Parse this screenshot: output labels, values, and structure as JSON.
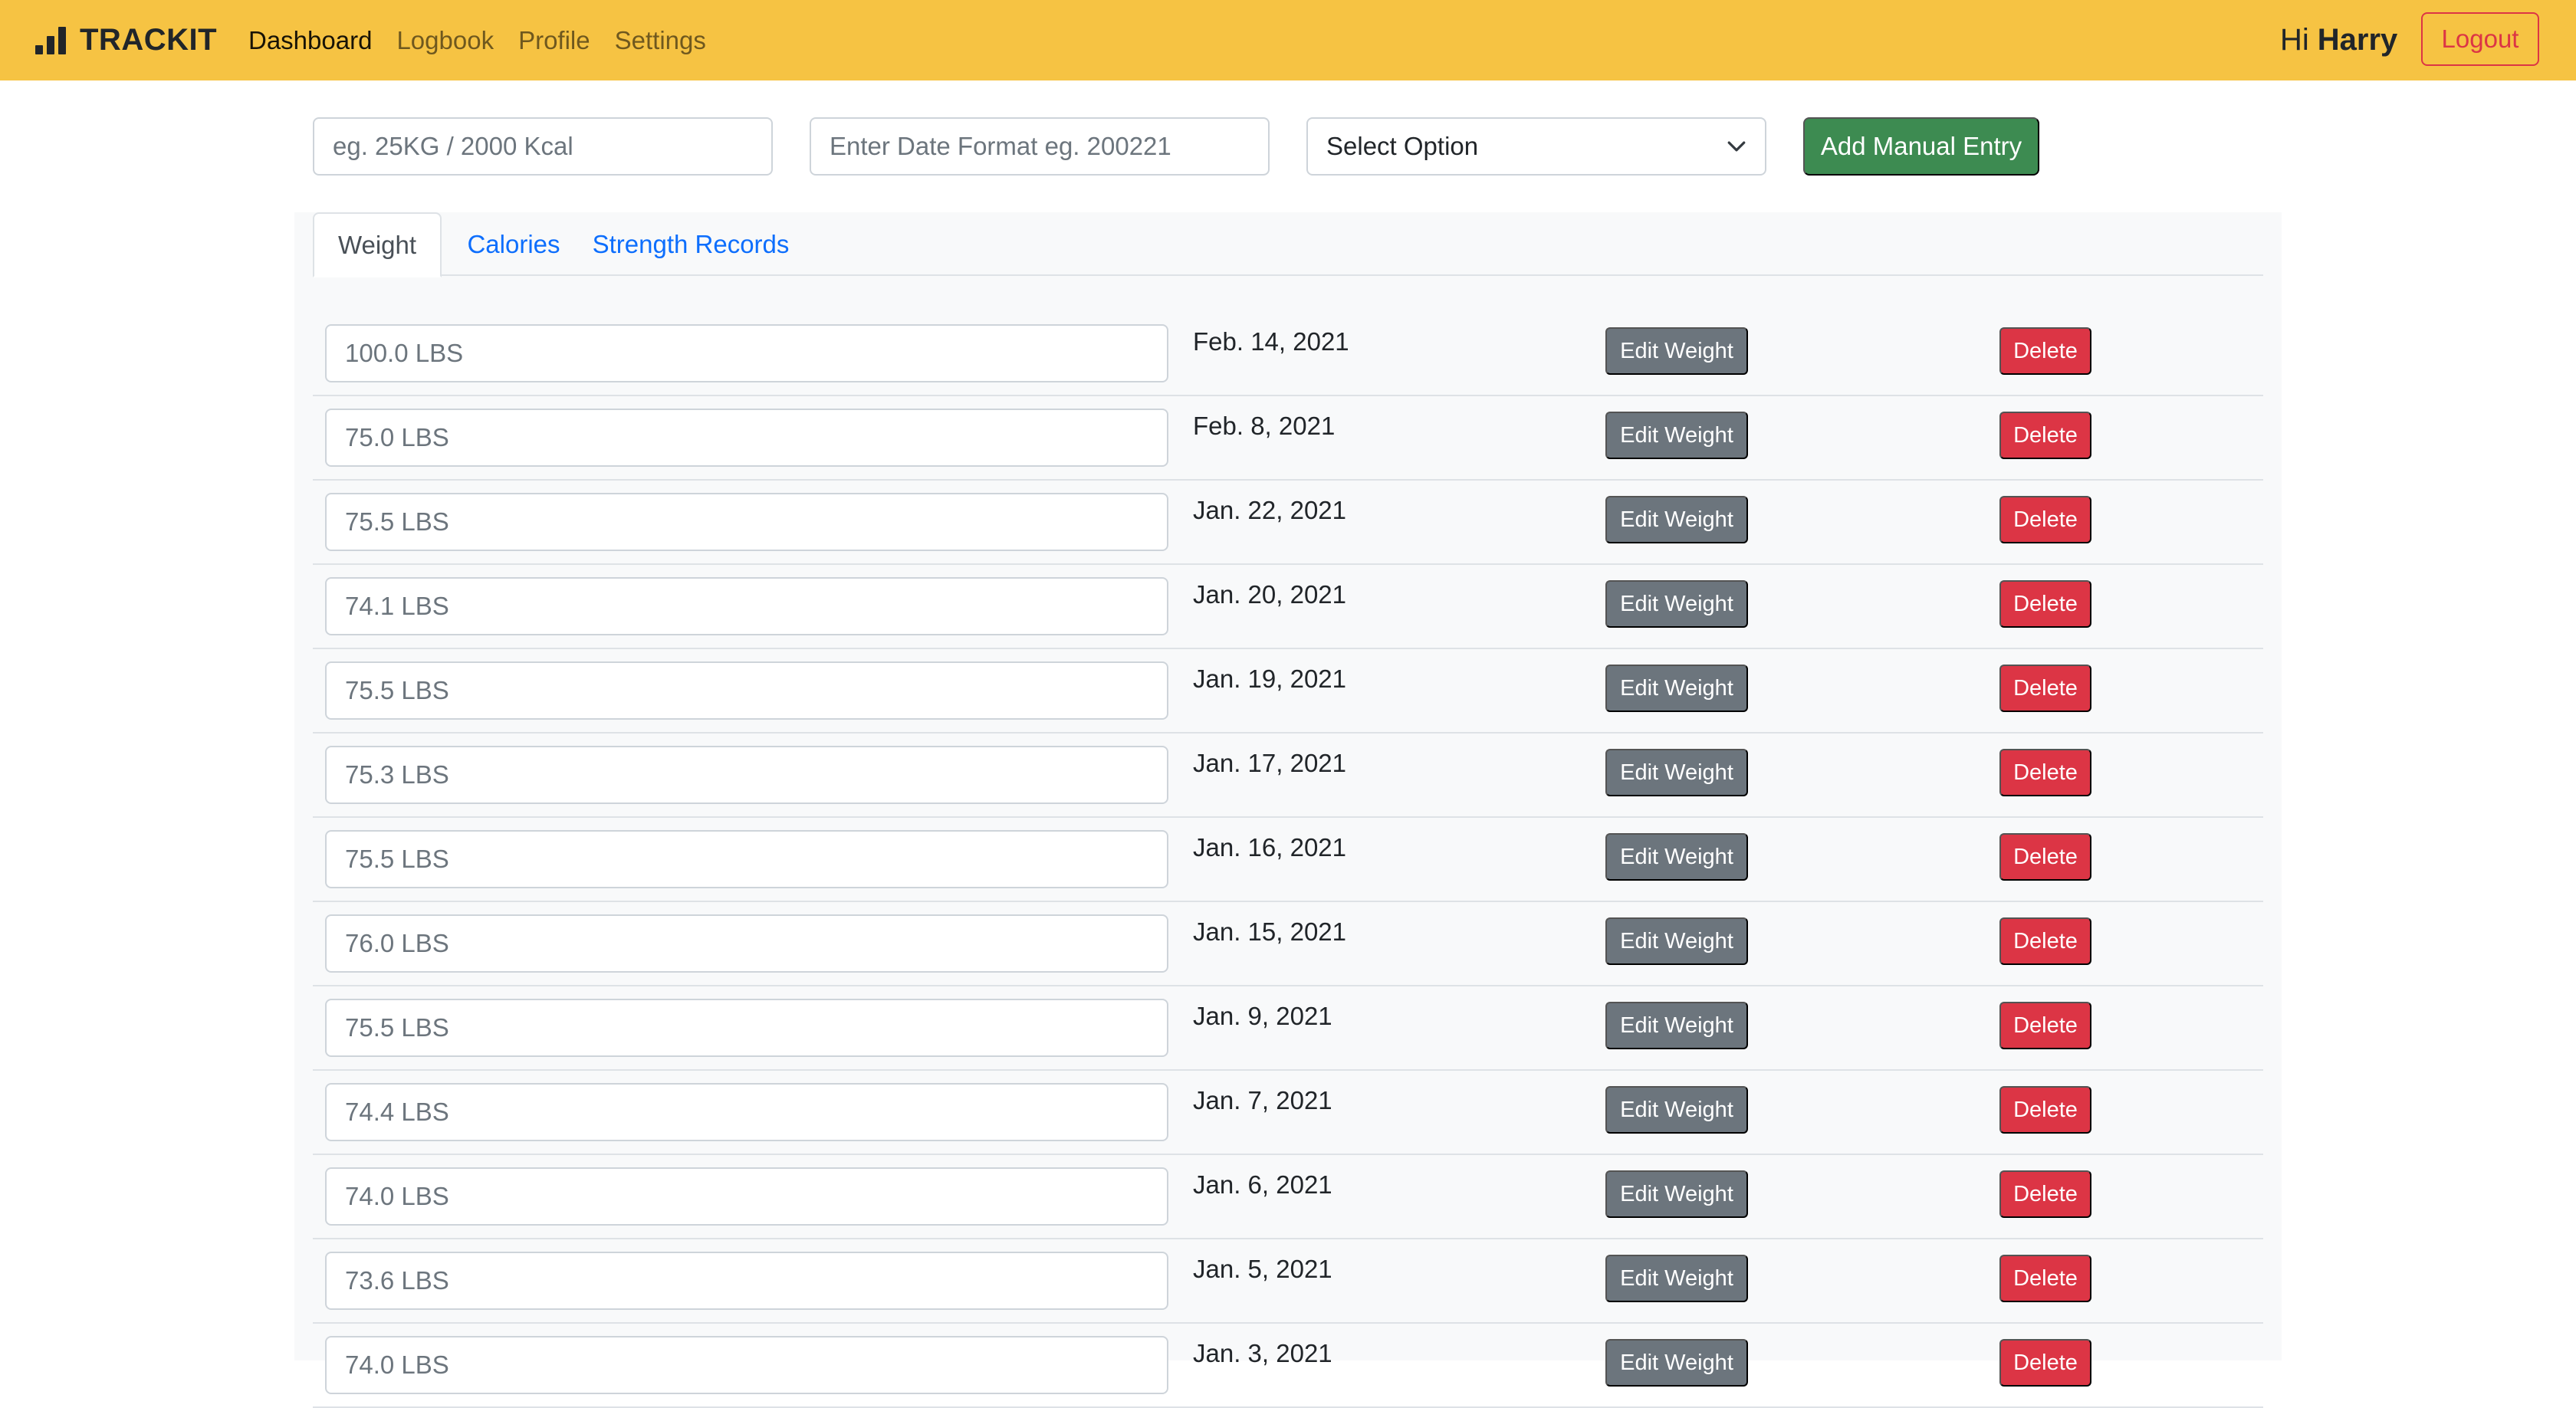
{
  "navbar": {
    "brand": "TRACKIT",
    "links": [
      "Dashboard",
      "Logbook",
      "Profile",
      "Settings"
    ],
    "active_link": "Dashboard",
    "greeting_prefix": "Hi",
    "user_name": "Harry",
    "logout_label": "Logout"
  },
  "entry_form": {
    "value_placeholder": "eg. 25KG / 2000 Kcal",
    "date_placeholder": "Enter Date Format eg. 200221",
    "select_value": "Select Option",
    "add_button_label": "Add Manual Entry"
  },
  "tabs": [
    {
      "label": "Weight",
      "active": true
    },
    {
      "label": "Calories",
      "active": false
    },
    {
      "label": "Strength Records",
      "active": false
    }
  ],
  "weight_entries": [
    {
      "value": "100.0 LBS",
      "date": "Feb. 14, 2021"
    },
    {
      "value": "75.0 LBS",
      "date": "Feb. 8, 2021"
    },
    {
      "value": "75.5 LBS",
      "date": "Jan. 22, 2021"
    },
    {
      "value": "74.1 LBS",
      "date": "Jan. 20, 2021"
    },
    {
      "value": "75.5 LBS",
      "date": "Jan. 19, 2021"
    },
    {
      "value": "75.3 LBS",
      "date": "Jan. 17, 2021"
    },
    {
      "value": "75.5 LBS",
      "date": "Jan. 16, 2021"
    },
    {
      "value": "76.0 LBS",
      "date": "Jan. 15, 2021"
    },
    {
      "value": "75.5 LBS",
      "date": "Jan. 9, 2021"
    },
    {
      "value": "74.4 LBS",
      "date": "Jan. 7, 2021"
    },
    {
      "value": "74.0 LBS",
      "date": "Jan. 6, 2021"
    },
    {
      "value": "73.6 LBS",
      "date": "Jan. 5, 2021"
    },
    {
      "value": "74.0 LBS",
      "date": "Jan. 3, 2021"
    }
  ],
  "row_actions": {
    "edit_label": "Edit Weight",
    "delete_label": "Delete"
  },
  "colors": {
    "navbar_bg": "#f6c343",
    "add_button": "#3d8b51",
    "edit_button": "#6c757d",
    "delete_button": "#dc3545",
    "tab_link": "#0d6efd"
  },
  "icons": {
    "brand": "bar-chart-icon",
    "select": "chevron-down-icon"
  }
}
